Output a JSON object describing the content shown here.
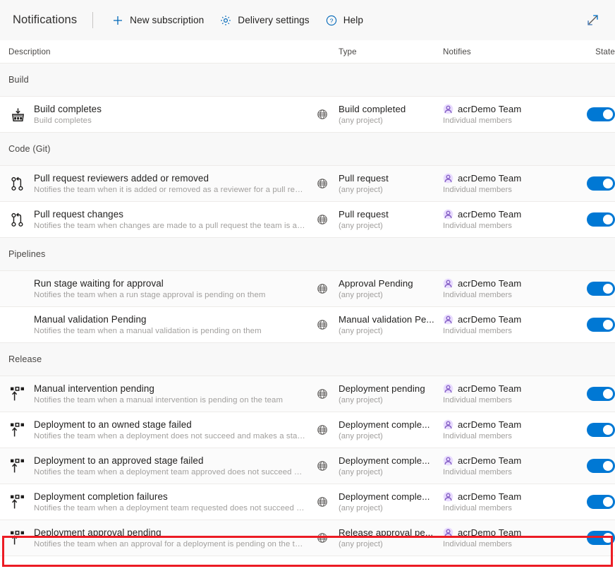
{
  "toolbar": {
    "title": "Notifications",
    "buttons": [
      {
        "label": "New subscription",
        "icon": "plus-icon"
      },
      {
        "label": "Delivery settings",
        "icon": "gear-icon"
      },
      {
        "label": "Help",
        "icon": "help-circle-icon"
      }
    ],
    "expand_icon": "expand-diagonal-icon"
  },
  "columns": {
    "description": "Description",
    "type": "Type",
    "notifies": "Notifies",
    "state": "State"
  },
  "colors": {
    "toggle_on": "#0078d4",
    "accent_link": "#0067b8",
    "annotation": "#ec1c24",
    "team_avatar": "#b4a0ff",
    "section_bg": "#f8f8f8"
  },
  "annotation": {
    "shape": "rectangle",
    "color": "#ec1c24",
    "target": "Deployment approval pending"
  },
  "sections": [
    {
      "label": "Build",
      "rows": [
        {
          "icon": "build-icon",
          "title": "Build completes",
          "subtitle": "Build completes",
          "scope_icon": "globe-icon",
          "type": "Build completed",
          "type_scope": "(any project)",
          "notifies": "acrDemo Team",
          "notifies_sub": "Individual members",
          "state": "on",
          "highlighted": false
        }
      ]
    },
    {
      "label": "Code (Git)",
      "rows": [
        {
          "icon": "pull-request-icon",
          "title": "Pull request reviewers added or removed",
          "subtitle": "Notifies the team when it is added or removed as a reviewer for a pull requ...",
          "scope_icon": "globe-icon",
          "type": "Pull request",
          "type_scope": "(any project)",
          "notifies": "acrDemo Team",
          "notifies_sub": "Individual members",
          "state": "on",
          "highlighted": false
        },
        {
          "icon": "pull-request-icon",
          "title": "Pull request changes",
          "subtitle": "Notifies the team when changes are made to a pull request the team is a r...",
          "scope_icon": "globe-icon",
          "type": "Pull request",
          "type_scope": "(any project)",
          "notifies": "acrDemo Team",
          "notifies_sub": "Individual members",
          "state": "on",
          "highlighted": false
        }
      ]
    },
    {
      "label": "Pipelines",
      "rows": [
        {
          "icon": "none",
          "title": "Run stage waiting for approval",
          "subtitle": "Notifies the team when a run stage approval is pending on them",
          "scope_icon": "globe-icon",
          "type": "Approval Pending",
          "type_scope": "(any project)",
          "notifies": "acrDemo Team",
          "notifies_sub": "Individual members",
          "state": "on",
          "highlighted": false
        },
        {
          "icon": "none",
          "title": "Manual validation Pending",
          "subtitle": "Notifies the team when a manual validation is pending on them",
          "scope_icon": "globe-icon",
          "type": "Manual validation Pe...",
          "type_scope": "(any project)",
          "notifies": "acrDemo Team",
          "notifies_sub": "Individual members",
          "state": "on",
          "highlighted": false
        }
      ]
    },
    {
      "label": "Release",
      "rows": [
        {
          "icon": "release-icon",
          "title": "Manual intervention pending",
          "subtitle": "Notifies the team when a manual intervention is pending on the team",
          "scope_icon": "globe-icon",
          "type": "Deployment pending",
          "type_scope": "(any project)",
          "notifies": "acrDemo Team",
          "notifies_sub": "Individual members",
          "state": "on",
          "highlighted": false
        },
        {
          "icon": "release-icon",
          "title": "Deployment to an owned stage failed",
          "subtitle": "Notifies the team when a deployment does not succeed and makes a stag...",
          "scope_icon": "globe-icon",
          "type": "Deployment comple...",
          "type_scope": "(any project)",
          "notifies": "acrDemo Team",
          "notifies_sub": "Individual members",
          "state": "on",
          "highlighted": false
        },
        {
          "icon": "release-icon",
          "title": "Deployment to an approved stage failed",
          "subtitle": "Notifies the team when a deployment team approved does not succeed an...",
          "scope_icon": "globe-icon",
          "type": "Deployment comple...",
          "type_scope": "(any project)",
          "notifies": "acrDemo Team",
          "notifies_sub": "Individual members",
          "state": "on",
          "highlighted": false
        },
        {
          "icon": "release-icon",
          "title": "Deployment completion failures",
          "subtitle": "Notifies the team when a deployment team requested does not succeed a...",
          "scope_icon": "globe-icon",
          "type": "Deployment comple...",
          "type_scope": "(any project)",
          "notifies": "acrDemo Team",
          "notifies_sub": "Individual members",
          "state": "on",
          "highlighted": false
        },
        {
          "icon": "release-icon",
          "title": "Deployment approval pending",
          "subtitle": "Notifies the team when an approval for a deployment is pending on the te...",
          "scope_icon": "globe-icon",
          "type": "Release approval pe...",
          "type_scope": "(any project)",
          "notifies": "acrDemo Team",
          "notifies_sub": "Individual members",
          "state": "on",
          "highlighted": true
        }
      ]
    }
  ]
}
